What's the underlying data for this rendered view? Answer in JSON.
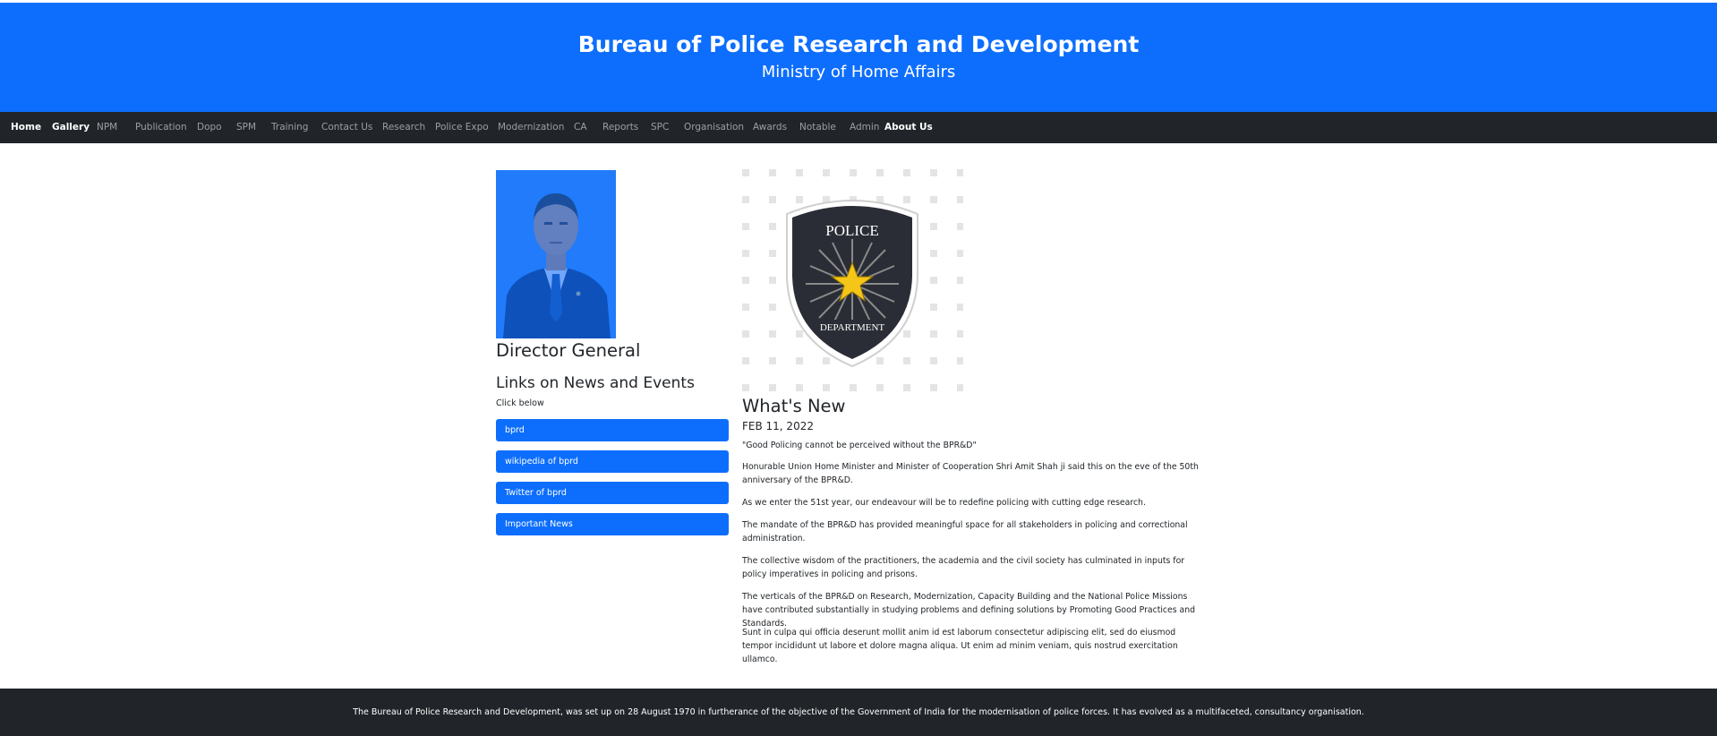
{
  "header": {
    "title": "Bureau of Police Research and Development",
    "subtitle": "Ministry of Home Affairs"
  },
  "nav": {
    "items": [
      "Home",
      "Gallery",
      "NPM",
      "Publication",
      "Dopo",
      "SPM",
      "Training",
      "Contact Us",
      "Research",
      "Police Expo",
      "Modernization",
      "CA",
      "Reports",
      "SPC",
      "Organisation",
      "Awards",
      "Notable",
      "Admin",
      "About Us"
    ],
    "active": [
      "Home",
      "Gallery",
      "About Us"
    ]
  },
  "sidebar": {
    "dg_title": "Director General",
    "links_heading": "Links on News and Events",
    "click_below": "Click below",
    "buttons": [
      "bprd",
      "wikipedia of bprd",
      "Twitter of bprd",
      "Important News"
    ]
  },
  "badge": {
    "top_text": "POLICE",
    "bottom_text": "DEPARTMENT"
  },
  "news": {
    "heading": "What's New",
    "date": "FEB 11, 2022",
    "paragraphs": [
      "\"Good Policing cannot be perceived without the BPR&D\"",
      "Honurable Union Home Minister and Minister of Cooperation Shri Amit Shah ji said this on the eve of the 50th anniversary of the BPR&D.",
      "As we enter the 51st year, our endeavour will be to redefine policing with cutting edge research.",
      "The mandate of the BPR&D has provided meaningful space for all stakeholders in policing and correctional administration.",
      "The collective wisdom of the practitioners, the academia and the civil society has culminated in inputs for policy imperatives in policing and prisons.",
      "The verticals of the BPR&D on Research, Modernization, Capacity Building and the National Police Missions have contributed substantially in studying problems and defining solutions by Promoting Good Practices and Standards.",
      "Sunt in culpa qui officia deserunt mollit anim id est laborum consectetur adipiscing elit, sed do eiusmod tempor incididunt ut labore et dolore magna aliqua. Ut enim ad minim veniam, quis nostrud exercitation ullamco."
    ]
  },
  "footer": {
    "text": "The Bureau of Police Research and Development, was set up on 28 August 1970 in furtherance of the objective of the Government of India for the modernisation of police forces. It has evolved as a multifaceted, consultancy organisation."
  },
  "colors": {
    "primary": "#0d6efd",
    "dark": "#212529"
  }
}
